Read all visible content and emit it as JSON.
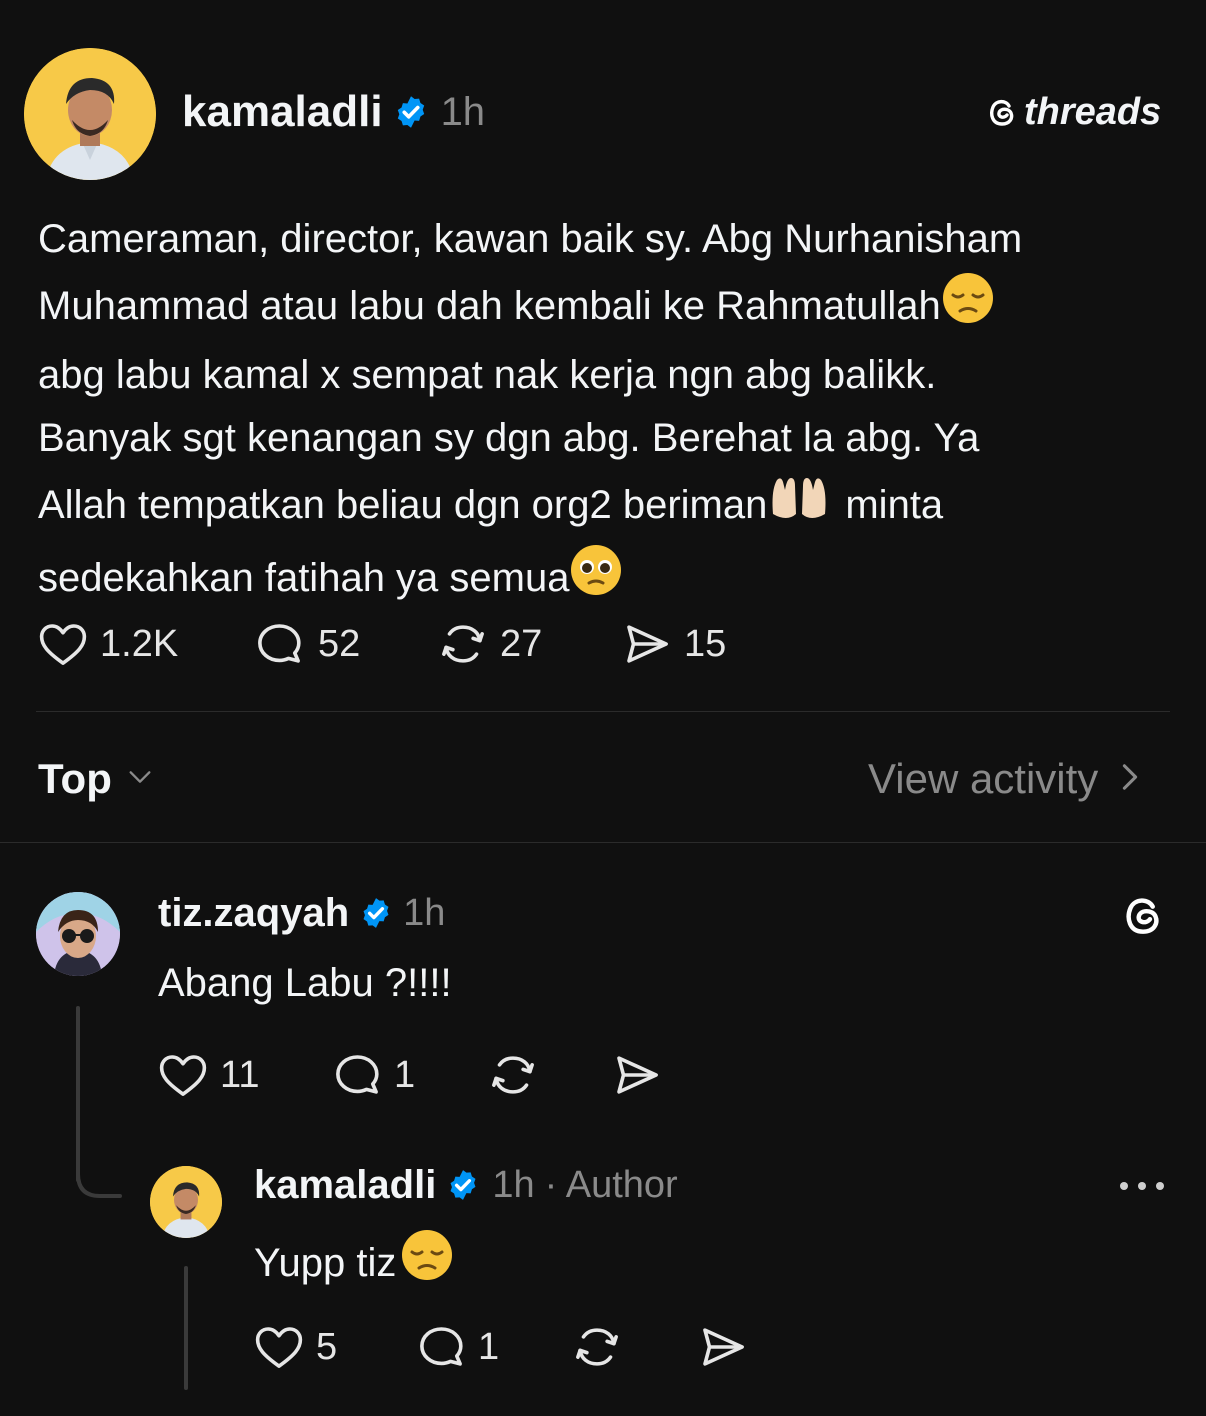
{
  "post": {
    "username": "kamaladli",
    "time": "1h",
    "brand": "threads",
    "text_lines": [
      "Cameraman, director, kawan baik sy. Abg Nurhanisham",
      "Muhammad atau labu  dah kembali ke Rahmatullah",
      "abg labu kamal x sempat nak kerja ngn abg balikk.",
      "Banyak sgt kenangan sy dgn abg. Berehat la abg. Ya",
      "Allah tempatkan beliau dgn org2 beriman",
      "minta",
      "sedekahkan fatihah ya semua"
    ],
    "likes": "1.2K",
    "replies": "52",
    "reposts": "27",
    "shares": "15"
  },
  "sort": {
    "label": "Top",
    "view_activity": "View activity"
  },
  "comment": {
    "username": "tiz.zaqyah",
    "time": "1h",
    "text": "Abang Labu ?!!!!",
    "likes": "11",
    "replies": "1"
  },
  "reply": {
    "username": "kamaladli",
    "time": "1h",
    "author_tag": "· Author",
    "text": "Yupp tiz",
    "likes": "5",
    "replies": "1"
  },
  "colors": {
    "background": "#101010",
    "text": "#f3f5f7",
    "muted": "#777777",
    "verified": "#0095f6",
    "avatar_bg": "#f7c948"
  },
  "icons": [
    "heart-icon",
    "comment-icon",
    "repost-icon",
    "share-icon",
    "verified-icon",
    "threads-logo-icon",
    "more-icon",
    "chevron-down-icon",
    "chevron-right-icon"
  ]
}
